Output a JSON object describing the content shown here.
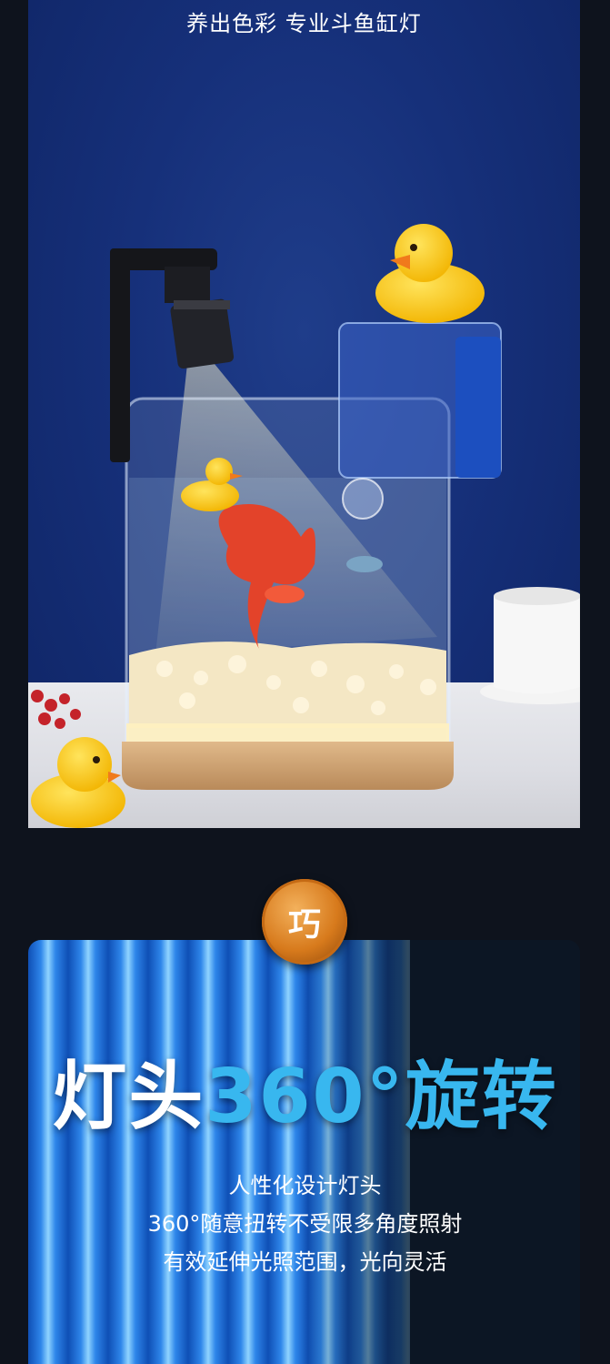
{
  "hero": {
    "title": "养出色彩 专业斗鱼缸灯"
  },
  "badge": {
    "label": "巧"
  },
  "headline": {
    "part1": "灯头",
    "part2": "360°",
    "part3": "旋转"
  },
  "description": {
    "lines": [
      "人性化设计灯头",
      "360°随意扭转不受限多角度照射",
      "有效延伸光照范围，光向灵活"
    ]
  },
  "colors": {
    "page_bg": "#0e131d",
    "hero_bg": "#16307a",
    "accent_blue": "#38b7ef",
    "badge_orange": "#d77a1c"
  }
}
